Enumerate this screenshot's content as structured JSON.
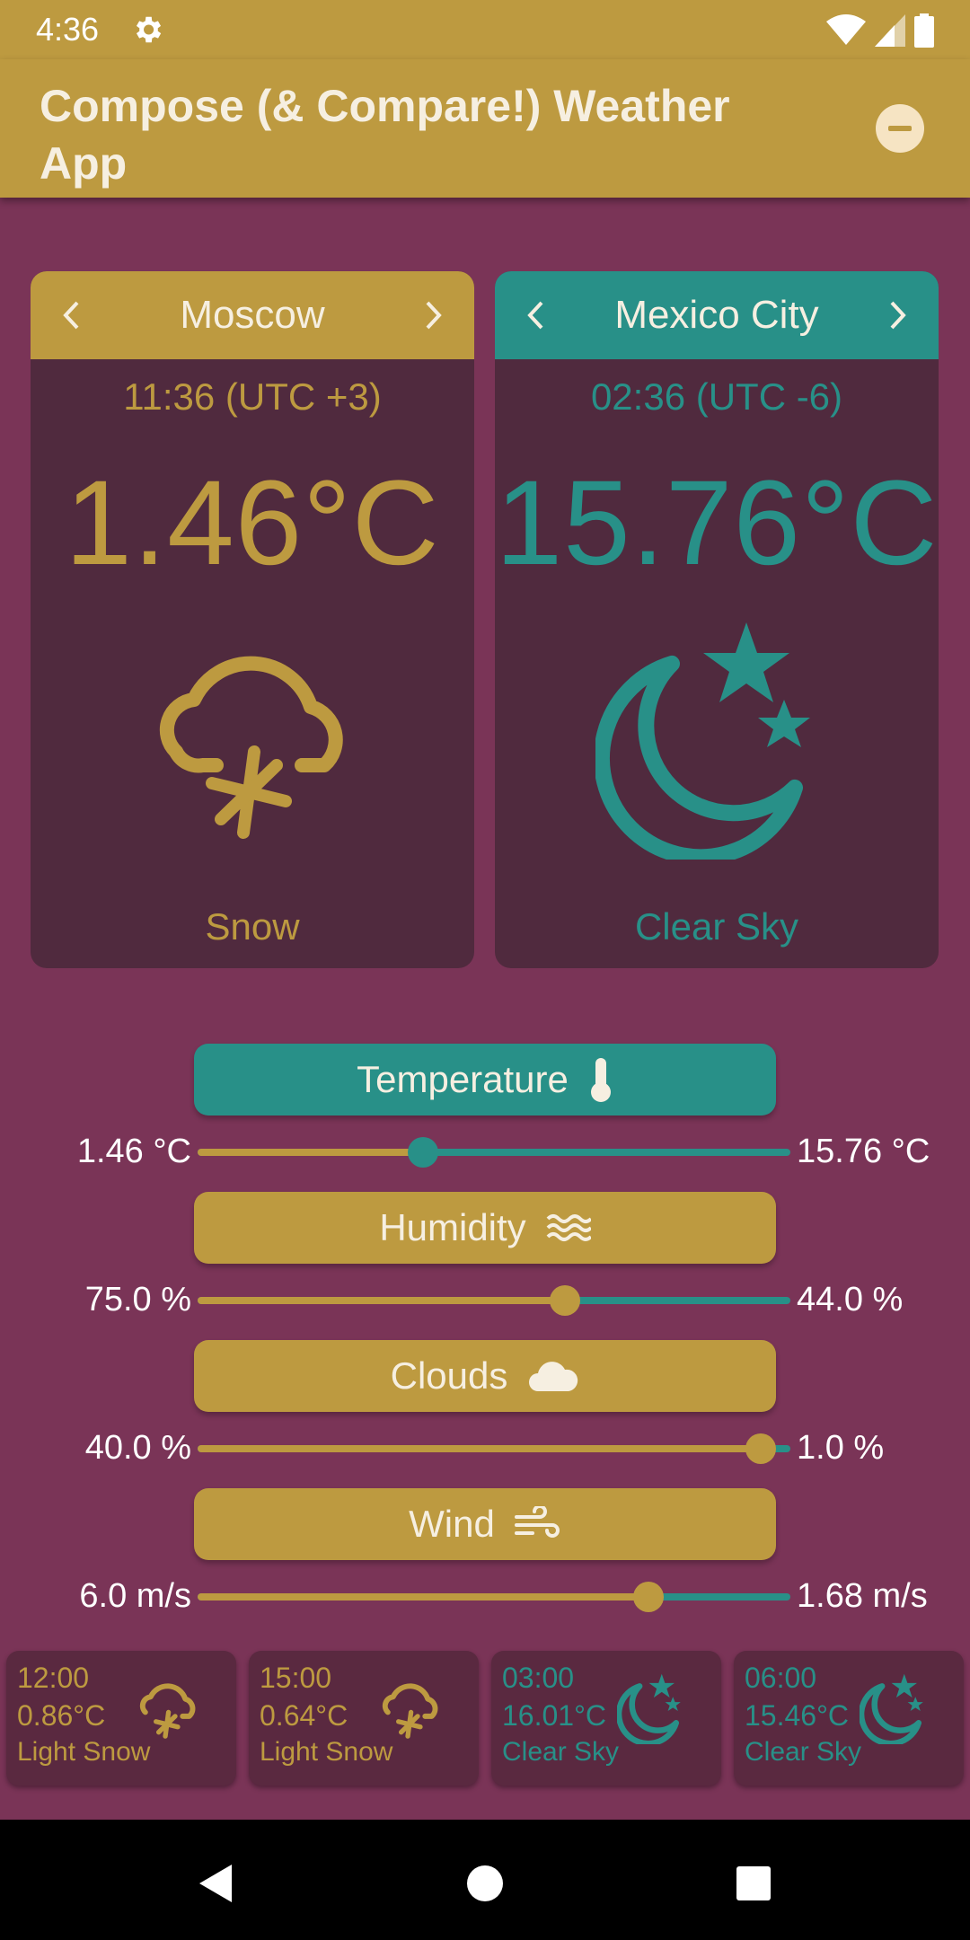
{
  "status": {
    "time": "4:36"
  },
  "app": {
    "title": "Compose (& Compare!) Weather App"
  },
  "cities": [
    {
      "name": "Moscow",
      "time": "11:36 (UTC +3)",
      "temp": "1.46°C",
      "condition": "Snow",
      "icon": "snow-cloud-icon",
      "color": "#bd9a40"
    },
    {
      "name": "Mexico City",
      "time": "02:36 (UTC -6)",
      "temp": "15.76°C",
      "condition": "Clear Sky",
      "icon": "moon-stars-icon",
      "color": "#289088"
    }
  ],
  "metrics": [
    {
      "label": "Temperature",
      "icon": "thermometer-icon",
      "left_value": "1.46 °C",
      "right_value": "15.76 °C",
      "level_percent": 38,
      "active": true
    },
    {
      "label": "Humidity",
      "icon": "waves-icon",
      "left_value": "75.0 %",
      "right_value": "44.0 %",
      "level_percent": 62,
      "active": false
    },
    {
      "label": "Clouds",
      "icon": "cloud-icon",
      "left_value": "40.0 %",
      "right_value": "1.0 %",
      "level_percent": 95,
      "active": false
    },
    {
      "label": "Wind",
      "icon": "wind-icon",
      "left_value": "6.0 m/s",
      "right_value": "1.68 m/s",
      "level_percent": 76,
      "active": false
    }
  ],
  "forecast": [
    {
      "time": "12:00",
      "temp": "0.86°C",
      "desc": "Light Snow",
      "icon": "snow-cloud-icon",
      "color": "#bd9a40"
    },
    {
      "time": "15:00",
      "temp": "0.64°C",
      "desc": "Light Snow",
      "icon": "snow-cloud-icon",
      "color": "#bd9a40"
    },
    {
      "time": "03:00",
      "temp": "16.01°C",
      "desc": "Clear Sky",
      "icon": "moon-stars-icon",
      "color": "#289088"
    },
    {
      "time": "06:00",
      "temp": "15.46°C",
      "desc": "Clear Sky",
      "icon": "moon-stars-icon",
      "color": "#289088"
    }
  ],
  "colors": {
    "gold": "#bd9a40",
    "teal": "#289088",
    "background": "#7a3457",
    "card": "#502a3e"
  }
}
